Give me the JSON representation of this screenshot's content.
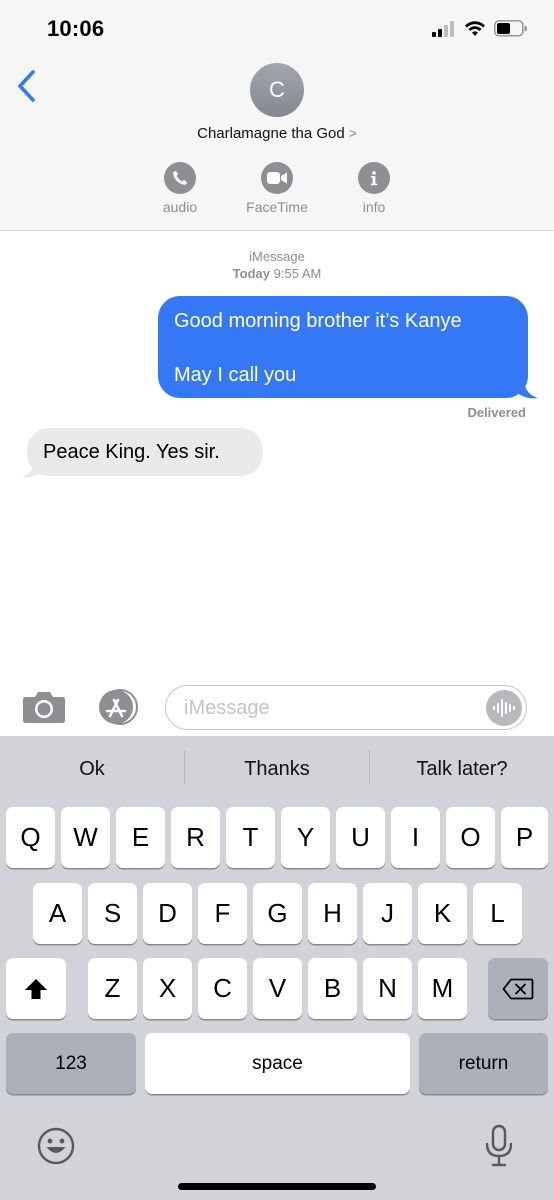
{
  "status": {
    "time": "10:06"
  },
  "contact": {
    "initial": "C",
    "name": "Charlamagne tha God",
    "chevron": ">"
  },
  "actions": [
    {
      "label": "audio",
      "icon": "phone-icon"
    },
    {
      "label": "FaceTime",
      "icon": "video-icon"
    },
    {
      "label": "info",
      "icon": "info-icon"
    }
  ],
  "thread": {
    "service": "iMessage",
    "day": "Today",
    "time": "9:55 AM",
    "messages": [
      {
        "from": "me",
        "lines": [
          "Good morning brother it’s Kanye",
          "May I call you"
        ]
      },
      {
        "from": "them",
        "text": "Peace King. Yes sir."
      }
    ],
    "status_text": "Delivered"
  },
  "composer": {
    "placeholder": "iMessage"
  },
  "keyboard": {
    "suggestions": [
      "Ok",
      "Thanks",
      "Talk later?"
    ],
    "row1": [
      "Q",
      "W",
      "E",
      "R",
      "T",
      "Y",
      "U",
      "I",
      "O",
      "P"
    ],
    "row2": [
      "A",
      "S",
      "D",
      "F",
      "G",
      "H",
      "J",
      "K",
      "L"
    ],
    "row3": [
      "Z",
      "X",
      "C",
      "V",
      "B",
      "N",
      "M"
    ],
    "numbers_label": "123",
    "space_label": "space",
    "return_label": "return"
  },
  "colors": {
    "bubble_out": "#3478f6",
    "bubble_in": "#e9e9eb",
    "accent": "#3478f6",
    "gray": "#8e8e93"
  }
}
